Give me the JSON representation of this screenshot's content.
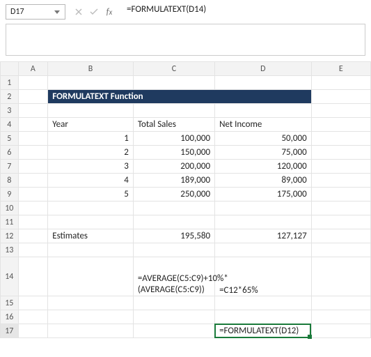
{
  "namebox": {
    "value": "D17"
  },
  "formula_bar": {
    "value": "=FORMULATEXT(D14)"
  },
  "columns": [
    "A",
    "B",
    "C",
    "D",
    "E"
  ],
  "rows": [
    "1",
    "2",
    "3",
    "4",
    "5",
    "6",
    "7",
    "8",
    "9",
    "10",
    "11",
    "12",
    "13",
    "14",
    "15",
    "16",
    "17"
  ],
  "banner": "FORMULATEXT  Function",
  "headers": {
    "year": "Year",
    "total_sales": "Total Sales",
    "net_income": "Net Income"
  },
  "data_rows": [
    {
      "year": "1",
      "sales": "100,000",
      "net": "50,000"
    },
    {
      "year": "2",
      "sales": "150,000",
      "net": "75,000"
    },
    {
      "year": "3",
      "sales": "200,000",
      "net": "120,000"
    },
    {
      "year": "4",
      "sales": "189,000",
      "net": "89,000"
    },
    {
      "year": "5",
      "sales": "250,000",
      "net": "175,000"
    }
  ],
  "estimates": {
    "label": "Estimates",
    "sales": "195,580",
    "net": "127,127"
  },
  "formula_display": {
    "c14": "=AVERAGE(C5:C9)+10%*(AVERAGE(C5:C9))",
    "d14": "=C12*65%",
    "d17": "=FORMULATEXT(D12)"
  },
  "chart_data": {
    "type": "table",
    "categories": [
      1,
      2,
      3,
      4,
      5
    ],
    "series": [
      {
        "name": "Total Sales",
        "values": [
          100000,
          150000,
          200000,
          189000,
          250000
        ]
      },
      {
        "name": "Net Income",
        "values": [
          50000,
          75000,
          120000,
          89000,
          175000
        ]
      }
    ],
    "estimates": {
      "Total Sales": 195580,
      "Net Income": 127127
    }
  }
}
